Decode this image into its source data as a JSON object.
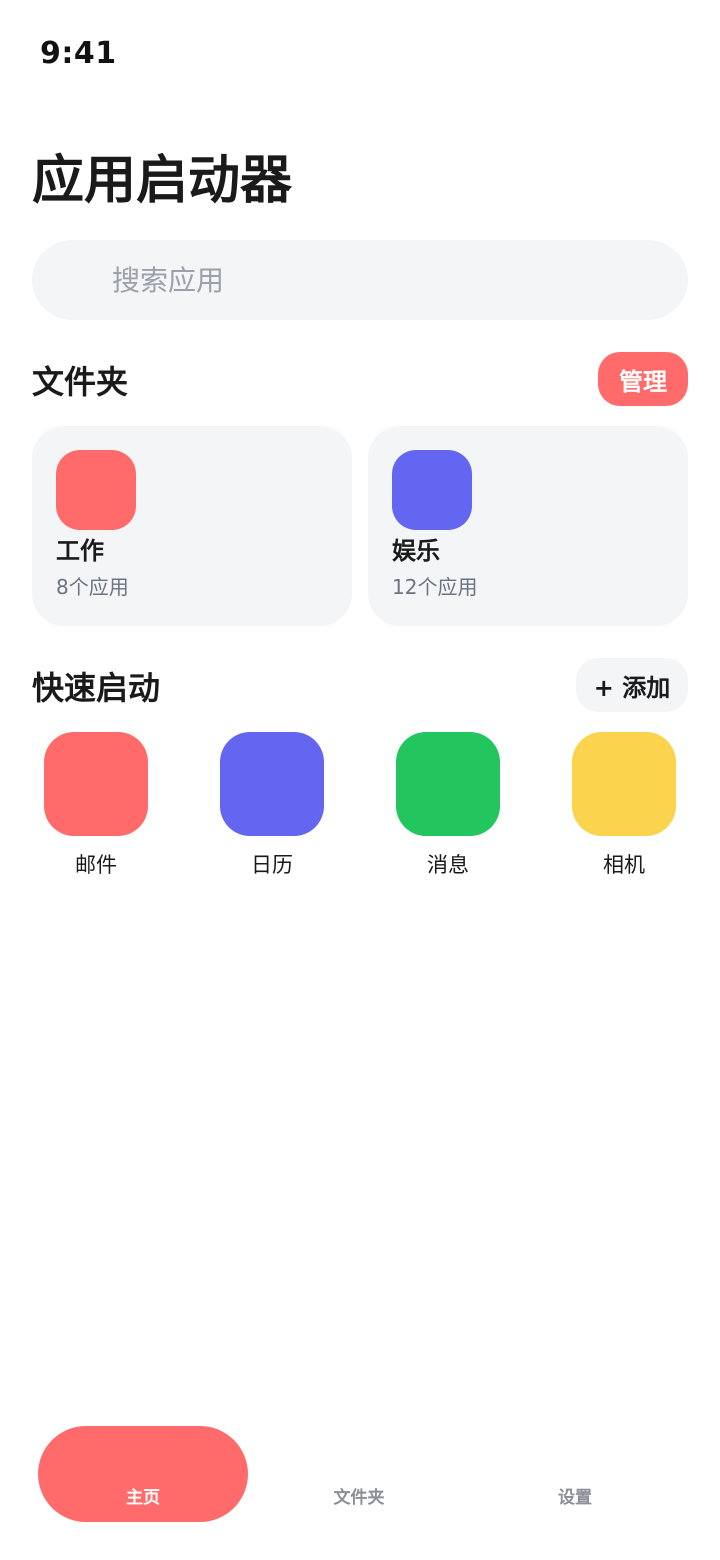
{
  "status_bar": {
    "time": "9:41"
  },
  "page_title": "应用启动器",
  "search": {
    "placeholder": "搜索应用",
    "value": "",
    "icon": "search-icon"
  },
  "folders_section": {
    "title": "文件夹",
    "manage_label": "管理",
    "folders": [
      {
        "name": "工作",
        "count": "8个应用",
        "color": "#ff6b6b"
      },
      {
        "name": "娱乐",
        "count": "12个应用",
        "color": "#6366f1"
      }
    ]
  },
  "quick_section": {
    "title": "快速启动",
    "add_label": "+ 添加",
    "apps": [
      {
        "label": "邮件",
        "color": "#ff6b6b"
      },
      {
        "label": "日历",
        "color": "#6366f1"
      },
      {
        "label": "消息",
        "color": "#22c55e"
      },
      {
        "label": "相机",
        "color": "#fcd34d"
      }
    ]
  },
  "tab_bar": {
    "active_color": "#ff6b6b",
    "tabs": [
      {
        "label": "主页",
        "active": true
      },
      {
        "label": "文件夹",
        "active": false
      },
      {
        "label": "设置",
        "active": false
      }
    ]
  }
}
